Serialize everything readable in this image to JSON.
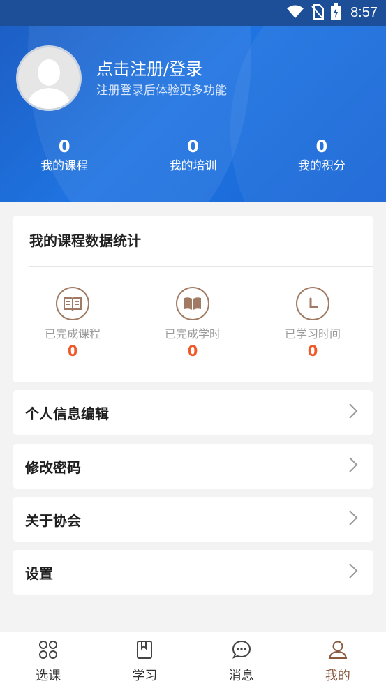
{
  "status_bar": {
    "time": "8:57",
    "icons": [
      "wifi-icon",
      "no-sim-icon",
      "battery-charging-icon"
    ]
  },
  "profile": {
    "avatar_icon": "default-avatar-icon",
    "login_title": "点击注册/登录",
    "login_subtitle": "注册登录后体验更多功能"
  },
  "summary": [
    {
      "value": "0",
      "label": "我的课程"
    },
    {
      "value": "0",
      "label": "我的培训"
    },
    {
      "value": "0",
      "label": "我的积分"
    }
  ],
  "stats_card": {
    "title": "我的课程数据统计",
    "items": [
      {
        "icon": "book-list-icon",
        "label": "已完成课程",
        "value": "0"
      },
      {
        "icon": "open-book-icon",
        "label": "已完成学时",
        "value": "0"
      },
      {
        "icon": "clock-icon",
        "label": "已学习时间",
        "value": "0"
      }
    ]
  },
  "menu": [
    {
      "label": "个人信息编辑",
      "icon": "chevron-right-icon"
    },
    {
      "label": "修改密码",
      "icon": "chevron-right-icon"
    },
    {
      "label": "关于协会",
      "icon": "chevron-right-icon"
    },
    {
      "label": "设置",
      "icon": "chevron-right-icon"
    }
  ],
  "bottom_nav": [
    {
      "label": "选课",
      "icon": "grid-icon",
      "active": false
    },
    {
      "label": "学习",
      "icon": "notebook-icon",
      "active": false
    },
    {
      "label": "消息",
      "icon": "chat-icon",
      "active": false
    },
    {
      "label": "我的",
      "icon": "user-icon",
      "active": true
    }
  ],
  "colors": {
    "header_blue": "#1f74e2",
    "accent_brown": "#8a5a3f",
    "value_orange": "#ef5a2a"
  }
}
